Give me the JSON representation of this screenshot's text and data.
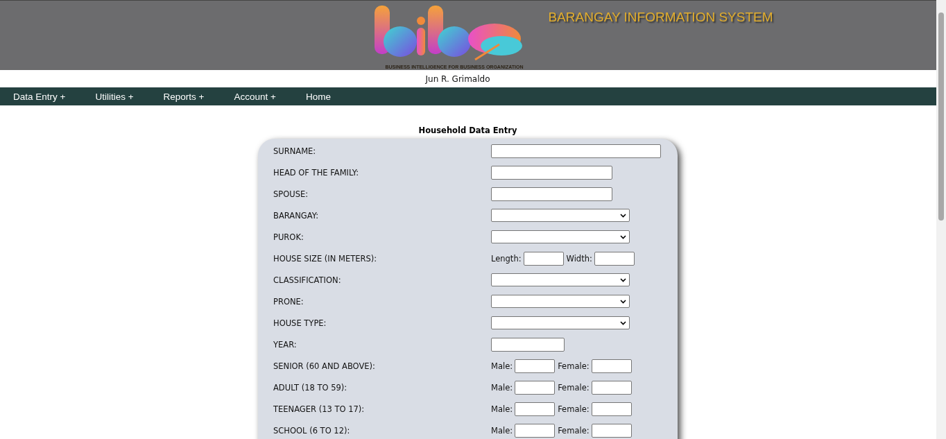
{
  "header": {
    "title": "BARANGAY INFORMATION SYSTEM",
    "tagline": "BUSINESS INTELLIGENCE FOR BUSINESS ORGANIZATION",
    "user": "Jun R. Grimaldo"
  },
  "nav": [
    {
      "label": "Data Entry +"
    },
    {
      "label": "Utilities +"
    },
    {
      "label": "Reports +"
    },
    {
      "label": "Account +"
    },
    {
      "label": "Home"
    }
  ],
  "form": {
    "title": "Household Data Entry",
    "rows": [
      {
        "label": "SURNAME:",
        "kind": "long-text"
      },
      {
        "label": "HEAD OF THE FAMILY:",
        "kind": "text"
      },
      {
        "label": "SPOUSE:",
        "kind": "text"
      },
      {
        "label": "BARANGAY:",
        "kind": "select"
      },
      {
        "label": "PUROK:",
        "kind": "select"
      },
      {
        "label": "HOUSE SIZE (IN METERS):",
        "kind": "pair",
        "first": "Length:",
        "second": "Width:"
      },
      {
        "label": "CLASSIFICATION:",
        "kind": "select"
      },
      {
        "label": "PRONE:",
        "kind": "select"
      },
      {
        "label": "HOUSE TYPE:",
        "kind": "select"
      },
      {
        "label": "YEAR:",
        "kind": "short-text"
      },
      {
        "label": "SENIOR (60 AND ABOVE):",
        "kind": "pair",
        "first": "Male:",
        "second": "Female:"
      },
      {
        "label": "ADULT (18 TO 59):",
        "kind": "pair",
        "first": "Male:",
        "second": "Female:"
      },
      {
        "label": "TEENAGER (13 TO 17):",
        "kind": "pair",
        "first": "Male:",
        "second": "Female:"
      },
      {
        "label": "SCHOOL (6 TO 12):",
        "kind": "pair",
        "first": "Male:",
        "second": "Female:"
      }
    ]
  }
}
